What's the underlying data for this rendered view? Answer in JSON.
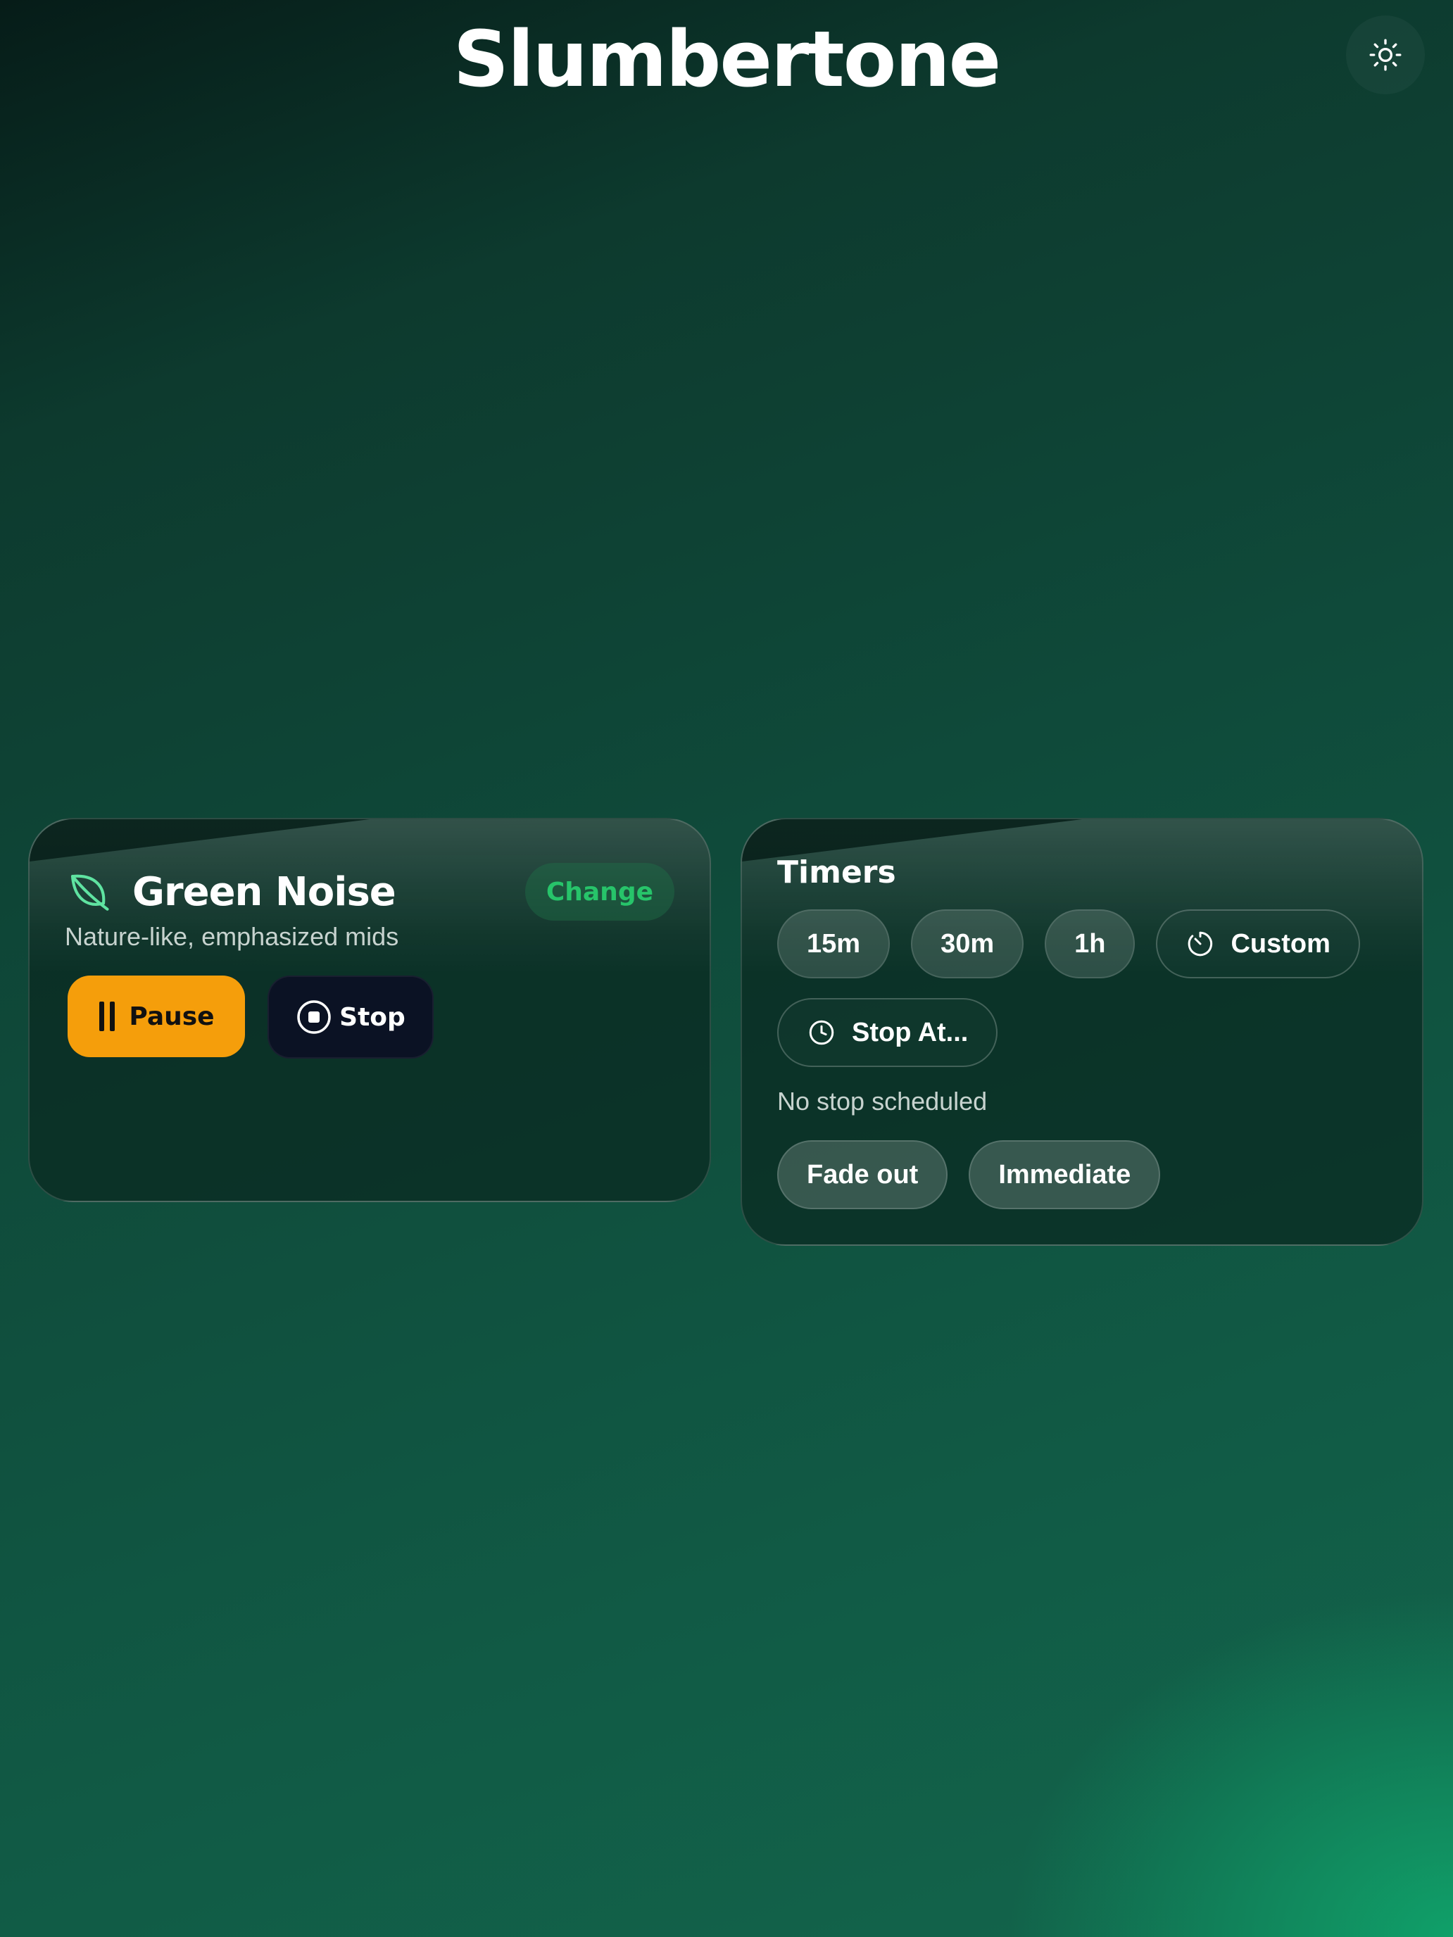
{
  "app": {
    "title": "Slumbertone"
  },
  "header": {
    "theme_toggle_icon": "sun-icon"
  },
  "sound_card": {
    "icon": "leaf-icon",
    "title": "Green Noise",
    "description": "Nature-like, emphasized mids",
    "change_label": "Change",
    "pause_label": "Pause",
    "stop_label": "Stop"
  },
  "timers_card": {
    "title": "Timers",
    "presets": [
      "15m",
      "30m",
      "1h"
    ],
    "custom_label": "Custom",
    "stop_at_label": "Stop At...",
    "status": "No stop scheduled",
    "modes": [
      "Fade out",
      "Immediate"
    ]
  },
  "colors": {
    "accent_pause": "#f59e0b",
    "accent_change": "#27c46a",
    "stop_button": "#0b1224"
  }
}
